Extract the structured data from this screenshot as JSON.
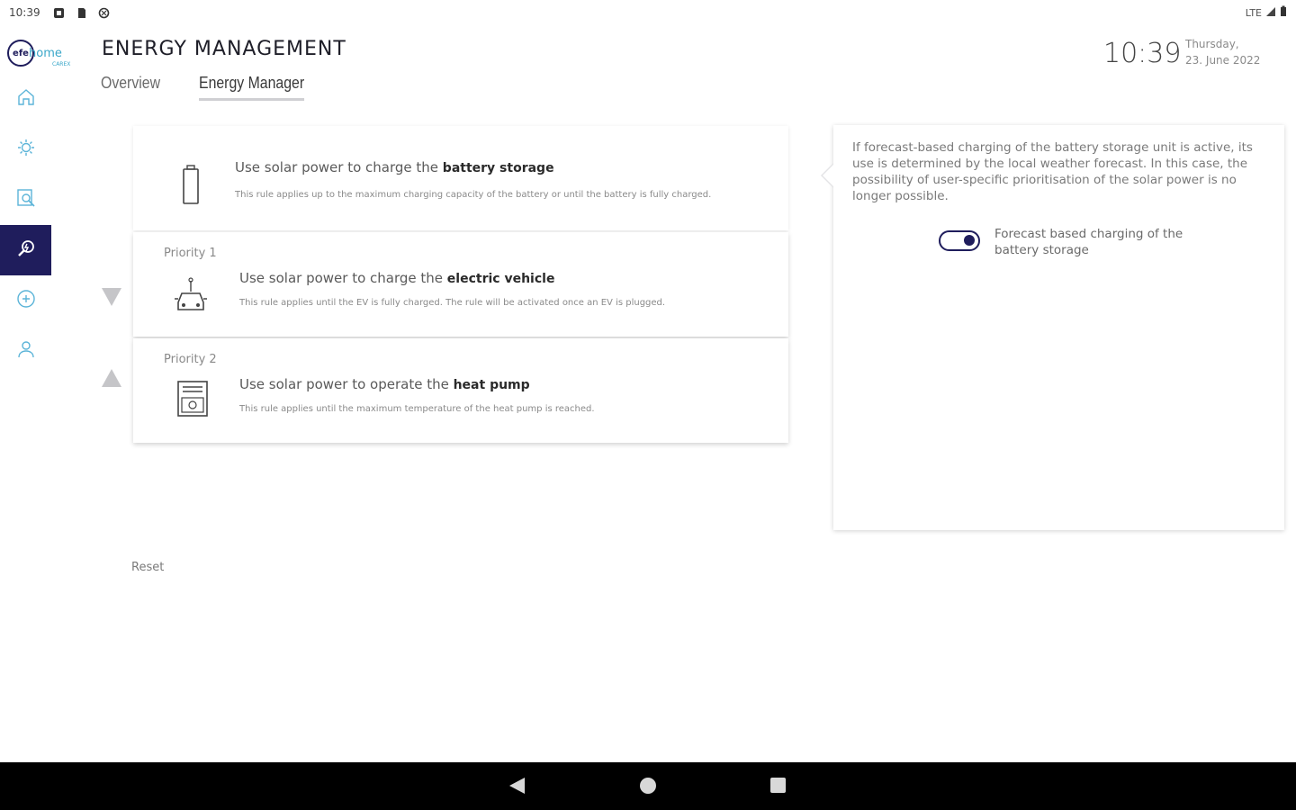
{
  "statusbar": {
    "time": "10:39",
    "network": "LTE"
  },
  "logo": {
    "mark": "efe",
    "text": "home",
    "sub": "CAREX"
  },
  "sidebar": {
    "items": [
      {
        "icon": "home-icon",
        "active": false
      },
      {
        "icon": "sun-icon",
        "active": false
      },
      {
        "icon": "analysis-icon",
        "active": false
      },
      {
        "icon": "energy-manager-icon",
        "active": true
      },
      {
        "icon": "plus-circle-icon",
        "active": false
      },
      {
        "icon": "user-icon",
        "active": false
      }
    ]
  },
  "header": {
    "title": "ENERGY MANAGEMENT",
    "tabs": [
      {
        "label": "Overview",
        "active": false
      },
      {
        "label": "Energy Manager",
        "active": true
      }
    ],
    "clock": "10:39",
    "weekday": "Thursday,",
    "date": "23. June 2022"
  },
  "rules": [
    {
      "priority": "",
      "title_prefix": "Use solar power to charge the ",
      "title_bold": "battery storage",
      "description": "This rule applies up to the maximum charging capacity of the battery or until the battery is fully charged.",
      "icon": "battery-icon"
    },
    {
      "priority": "Priority 1",
      "title_prefix": "Use solar power to charge the ",
      "title_bold": "electric vehicle",
      "description": "This rule applies until the EV is fully charged. The rule will be activated once an EV is plugged.",
      "icon": "car-icon"
    },
    {
      "priority": "Priority 2",
      "title_prefix": "Use solar power to operate the ",
      "title_bold": "heat pump",
      "description": "This rule applies until the maximum temperature of the heat pump is reached.",
      "icon": "heat-pump-icon"
    }
  ],
  "reset_label": "Reset",
  "info": {
    "text": "If forecast-based charging of the battery storage unit is active, its use is determined by the local weather forecast. In this case, the possibility of user-specific prioritisation of the solar power is no longer possible.",
    "toggle_label": "Forecast based charging of the battery storage",
    "toggle_on": true
  },
  "colors": {
    "accent": "#1f1d5c",
    "logo_teal": "#3aa7c9"
  }
}
